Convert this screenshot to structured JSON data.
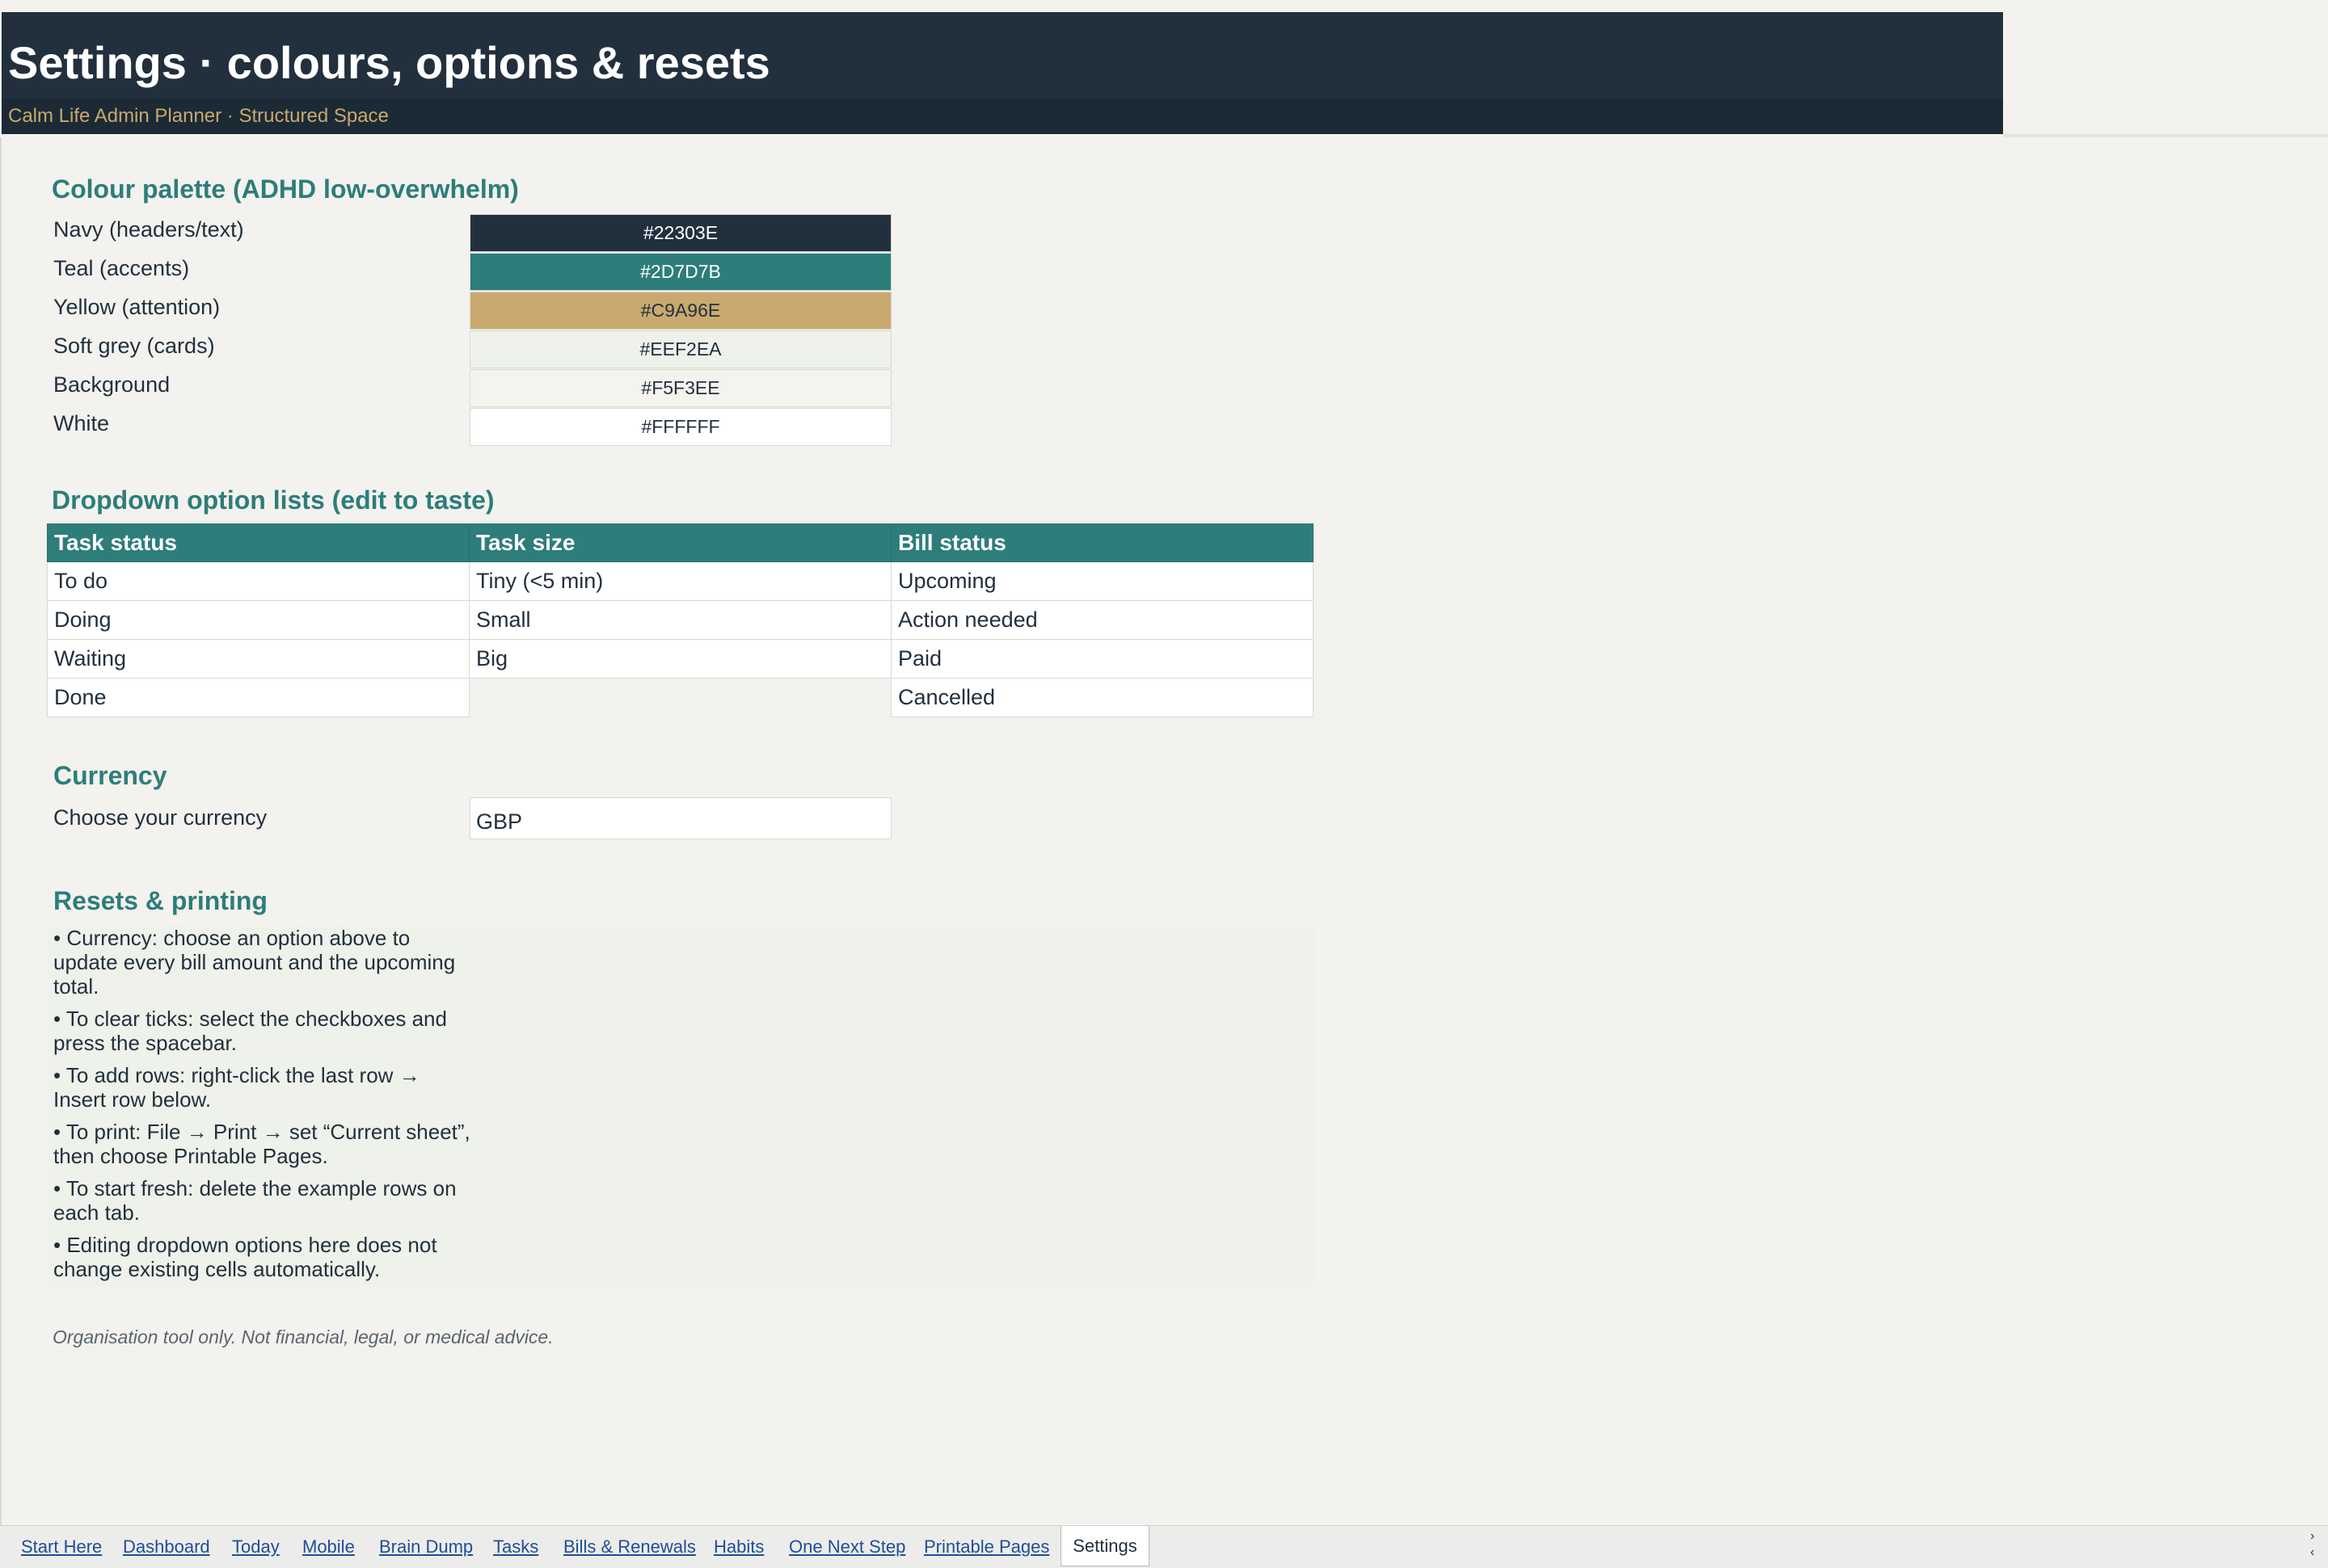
{
  "header": {
    "title": "Settings · colours, options & resets",
    "subtitle": "Calm Life Admin Planner · Structured Space"
  },
  "palette": {
    "title": "Colour palette (ADHD low-overwhelm)",
    "rows": [
      {
        "label": "Navy (headers/text)",
        "hex": "#22303E",
        "text_color": "#FFFFFF"
      },
      {
        "label": "Teal (accents)",
        "hex": "#2D7D7B",
        "text_color": "#FFFFFF"
      },
      {
        "label": "Yellow (attention)",
        "hex": "#C9A96E",
        "text_color": "#22303E"
      },
      {
        "label": "Soft grey (cards)",
        "hex": "#EEF2EA",
        "text_color": "#22303E"
      },
      {
        "label": "Background",
        "hex": "#F5F3EE",
        "text_color": "#22303E"
      },
      {
        "label": "White",
        "hex": "#FFFFFF",
        "text_color": "#22303E"
      }
    ]
  },
  "dropdowns": {
    "title": "Dropdown option lists (edit to taste)",
    "columns": [
      "Task status",
      "Task size",
      "Bill status"
    ],
    "rows": [
      [
        "To do",
        "Tiny (<5 min)",
        "Upcoming"
      ],
      [
        "Doing",
        "Small",
        "Action needed"
      ],
      [
        "Waiting",
        "Big",
        "Paid"
      ],
      [
        "Done",
        "",
        "Cancelled"
      ]
    ]
  },
  "currency": {
    "title": "Currency",
    "label": "Choose your currency",
    "value": "GBP"
  },
  "resets": {
    "title": "Resets & printing",
    "notes": [
      "• Currency: choose an option above to update every bill amount and the upcoming total.",
      "• To clear ticks: select the checkboxes and press the spacebar.",
      "• To add rows: right-click the last row → Insert row below.",
      "• To print: File → Print → set “Current sheet”, then choose Printable Pages.",
      "• To start fresh: delete the example rows on each tab.",
      "• Editing dropdown options here does not change existing cells automatically."
    ]
  },
  "disclaimer": "Organisation tool only. Not financial, legal, or medical advice.",
  "tabs": {
    "items": [
      "Start Here",
      "Dashboard",
      "Today",
      "Mobile",
      "Brain Dump",
      "Tasks",
      "Bills & Renewals",
      "Habits",
      "One Next Step",
      "Printable Pages"
    ],
    "active": "Settings"
  },
  "colors": {
    "navy": "#22303E",
    "teal": "#2D7D7B",
    "yellow": "#C9A96E",
    "soft_grey": "#EEF2EA",
    "background": "#F5F3EE"
  }
}
